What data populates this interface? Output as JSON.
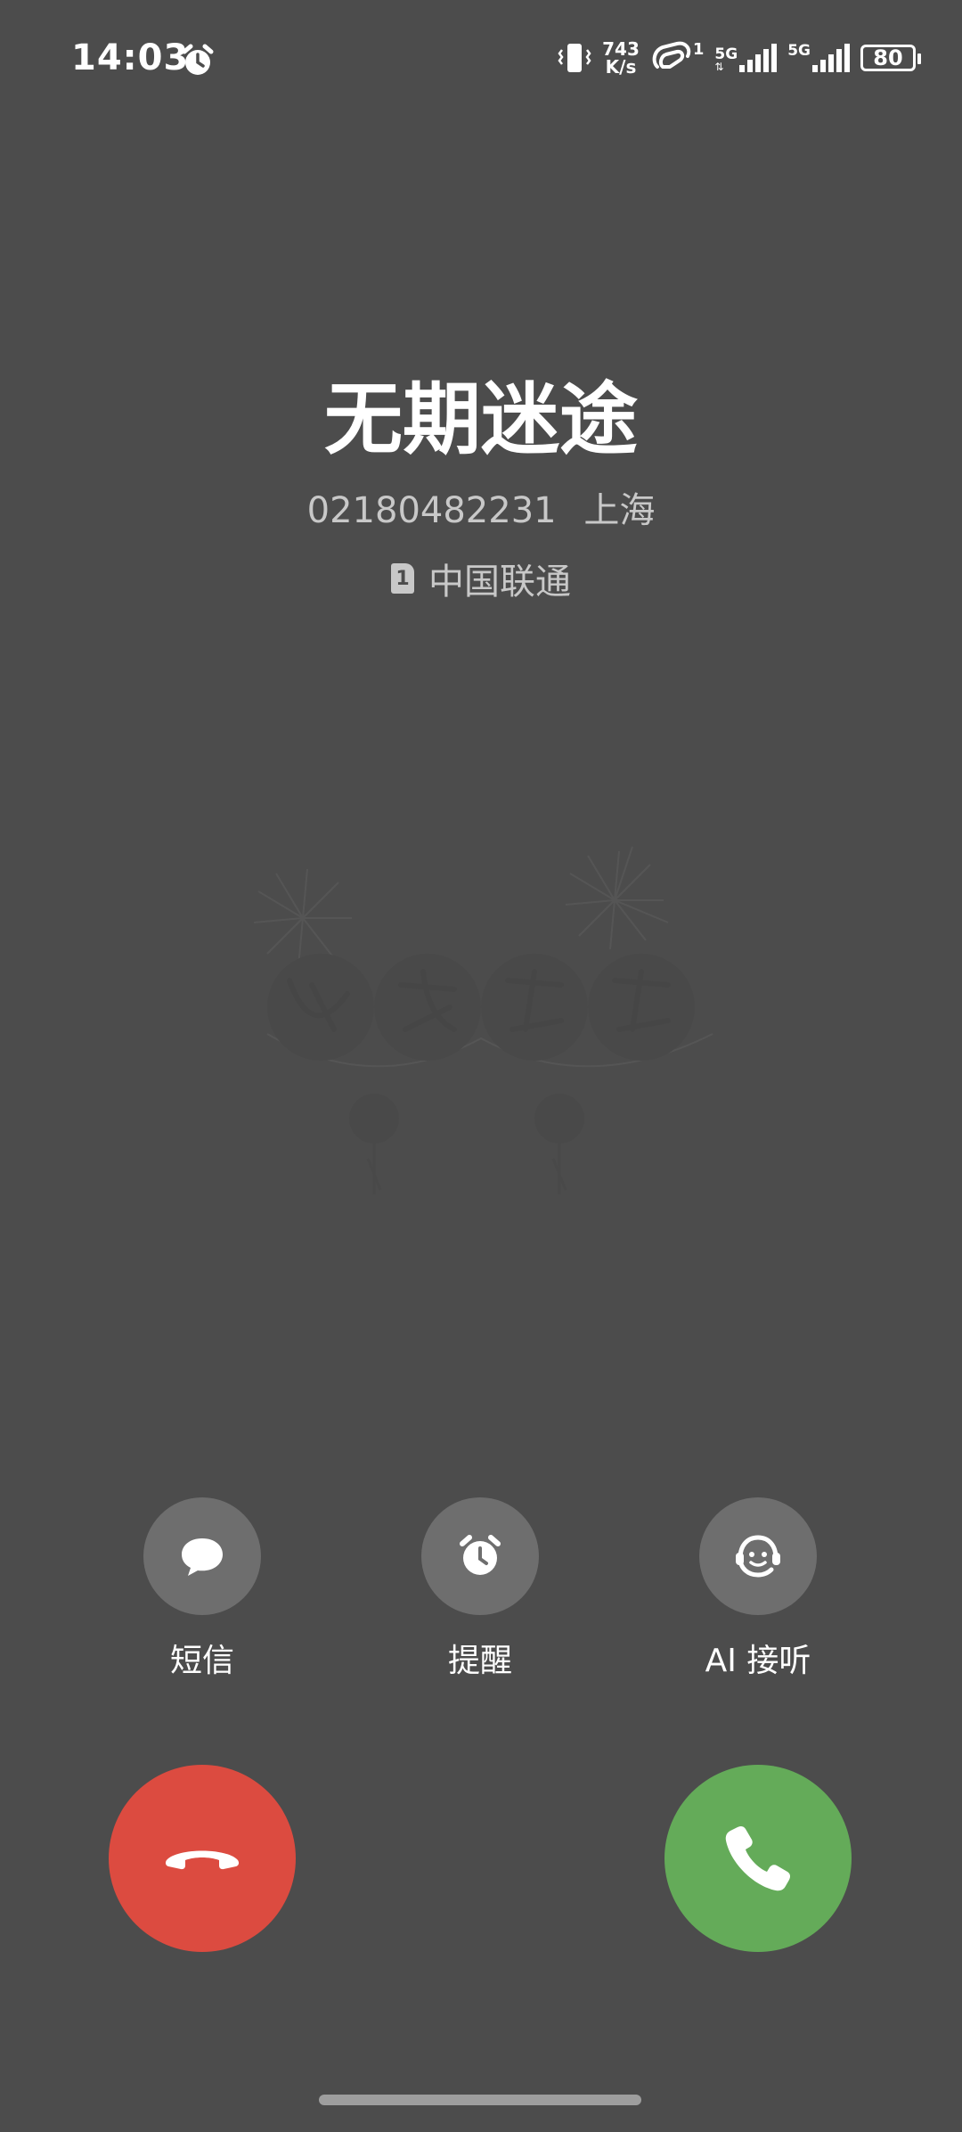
{
  "status_bar": {
    "time": "14:03",
    "net_speed_value": "743",
    "net_speed_unit": "K/s",
    "hd_badge": "1",
    "sim1_gen": "5G",
    "sim2_gen": "5G",
    "battery": "80"
  },
  "caller": {
    "name": "无期迷途",
    "number": "02180482231",
    "location": "上海",
    "sim_slot": "1",
    "carrier": "中国联通"
  },
  "actions": [
    {
      "label": "短信",
      "icon": "message-bubble-icon"
    },
    {
      "label": "提醒",
      "icon": "alarm-clock-icon"
    },
    {
      "label": "AI 接听",
      "icon": "ai-assistant-icon"
    }
  ],
  "colors": {
    "background": "#4c4c4c",
    "decline": "#dc4b40",
    "answer": "#64ab59",
    "action_circle": "#6e6e6e"
  }
}
